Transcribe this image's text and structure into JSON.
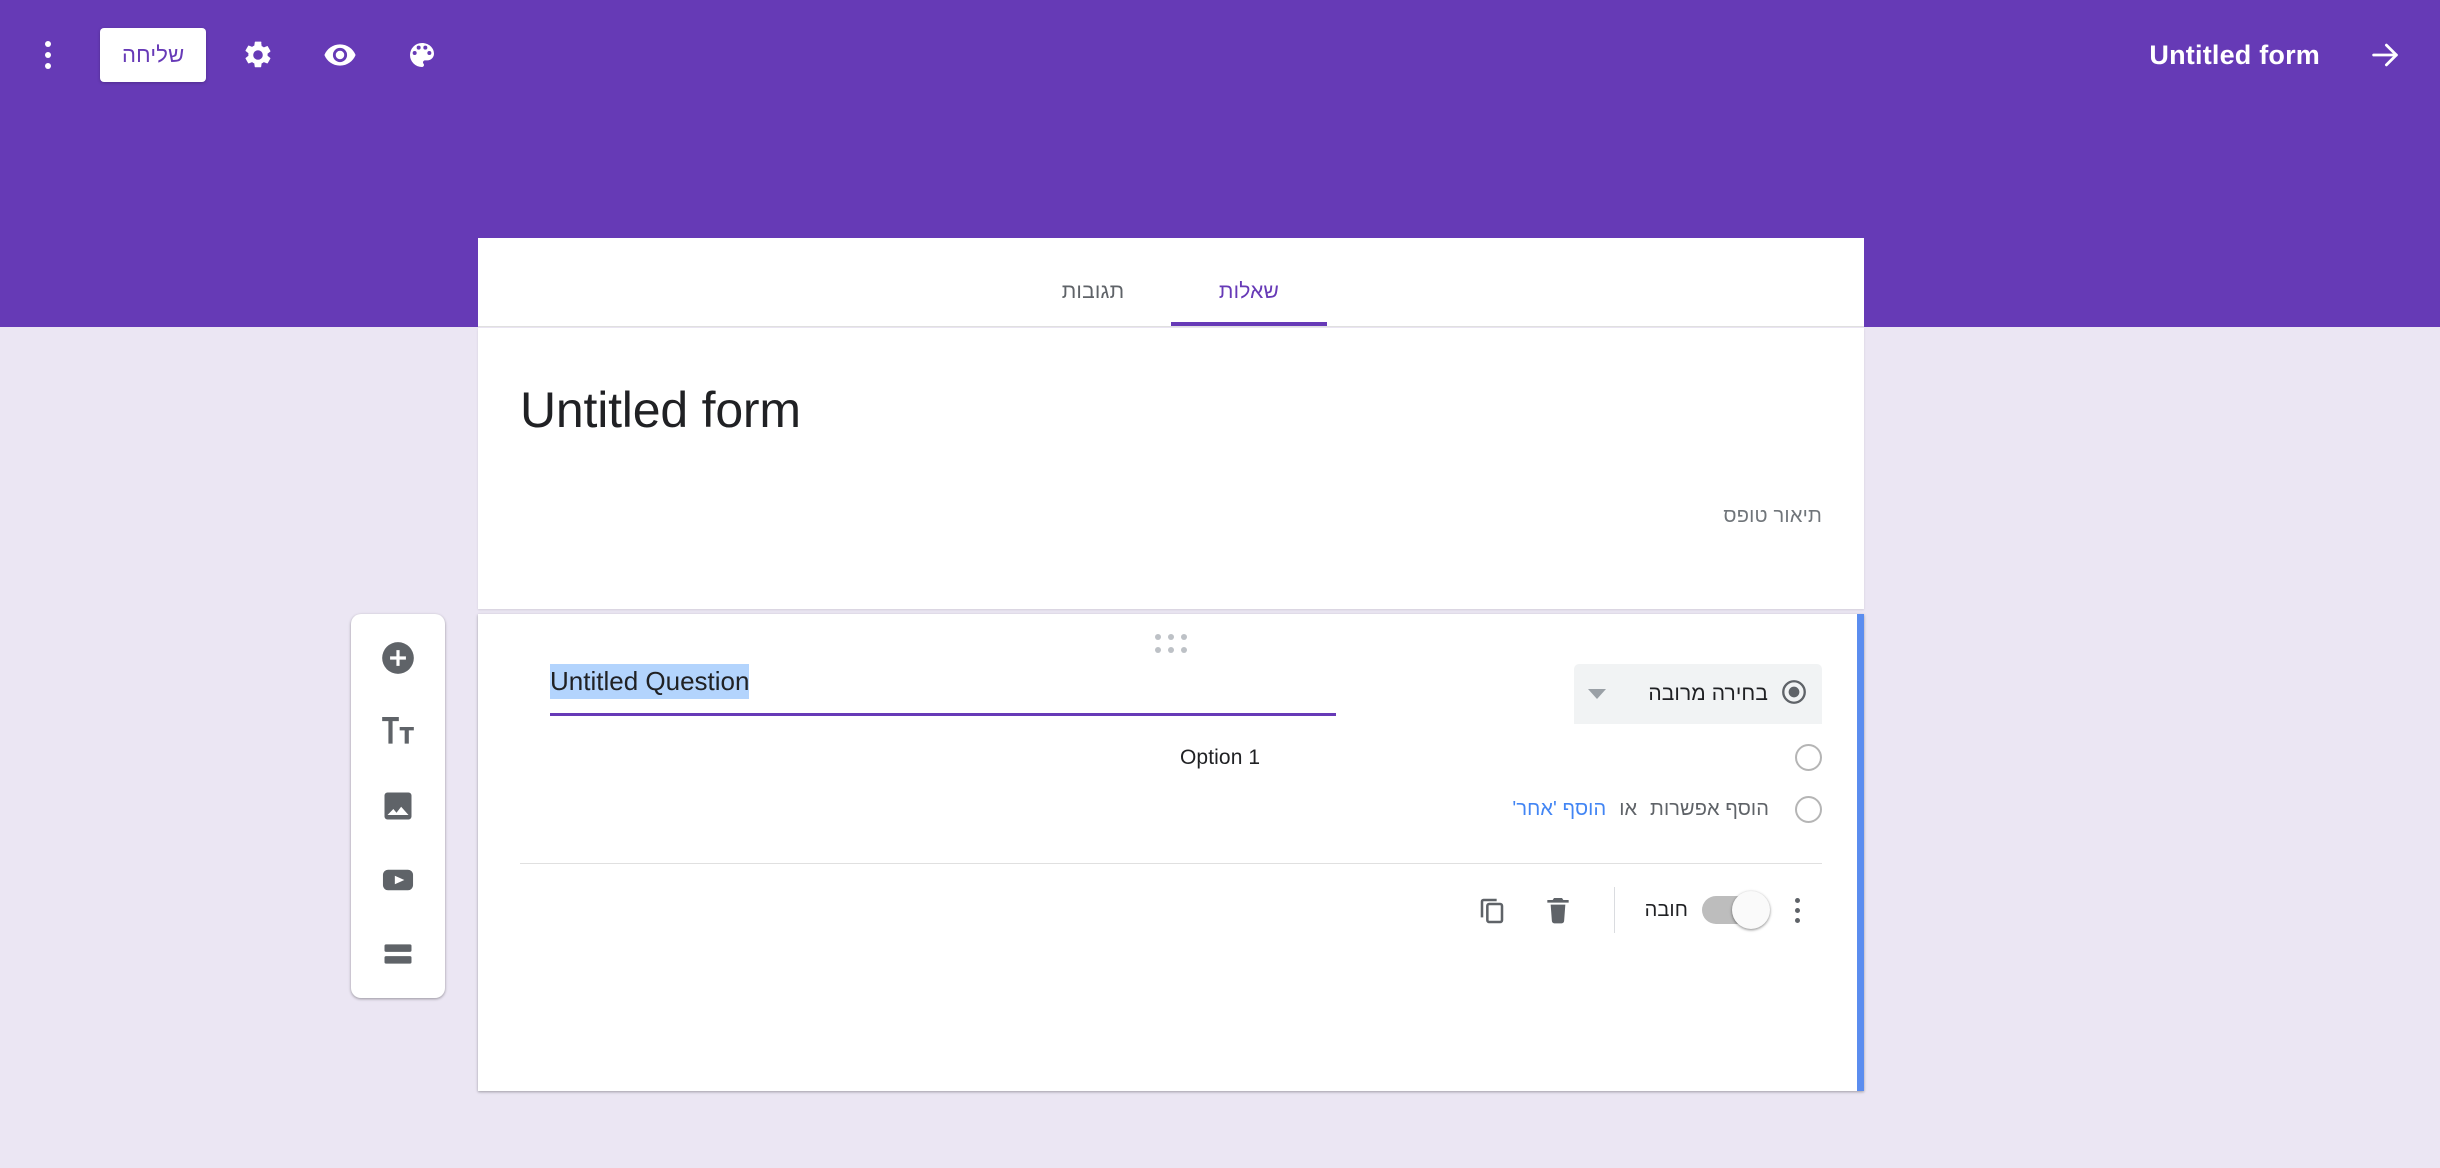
{
  "header": {
    "background_color": "#663AB6",
    "kebab_icon": "more-vert-icon",
    "send_label": "שליחה",
    "settings_icon": "gear-icon",
    "preview_icon": "eye-icon",
    "theme_icon": "palette-icon",
    "form_title": "Untitled form",
    "forward_icon": "arrow-right-icon"
  },
  "tabs": [
    {
      "label": "תגובות",
      "active": false,
      "name": "tab-responses"
    },
    {
      "label": "שאלות",
      "active": true,
      "name": "tab-questions"
    }
  ],
  "form": {
    "title": "Untitled form",
    "description_placeholder": "תיאור טופס"
  },
  "side_toolbar": {
    "items": [
      {
        "icon": "add-circle-icon",
        "name": "add-question-button"
      },
      {
        "icon": "title-text-icon",
        "name": "add-title-button"
      },
      {
        "icon": "image-icon",
        "name": "add-image-button"
      },
      {
        "icon": "video-icon",
        "name": "add-video-button"
      },
      {
        "icon": "section-icon",
        "name": "add-section-button"
      }
    ]
  },
  "question": {
    "drag_handle_icon": "drag-dots-icon",
    "title": "Untitled Question",
    "title_selected": true,
    "selection_color": "#b3d4fd",
    "underline_color": "#673AB7",
    "active_edge_color": "#5b8def",
    "type": {
      "label": "בחירה מרובה",
      "icon": "radio-button-icon",
      "caret_icon": "chevron-down-icon"
    },
    "options": [
      {
        "label": "Option 1",
        "radio_icon": "radio-empty-icon"
      }
    ],
    "add_row": {
      "radio_icon": "radio-empty-icon",
      "add_option_label": "הוסף אפשרות",
      "or_label": "או",
      "add_other_label": "הוסף 'אחר'",
      "add_other_color": "#4285f4"
    },
    "footer": {
      "kebab_icon": "more-vert-icon",
      "required_label": "חובה",
      "required_on": false,
      "delete_icon": "trash-icon",
      "duplicate_icon": "copy-icon"
    }
  },
  "colors": {
    "purple": "#663AB6",
    "page_background": "#EBE6F3",
    "card_background": "#ffffff",
    "accent_blue": "#4285f4"
  }
}
